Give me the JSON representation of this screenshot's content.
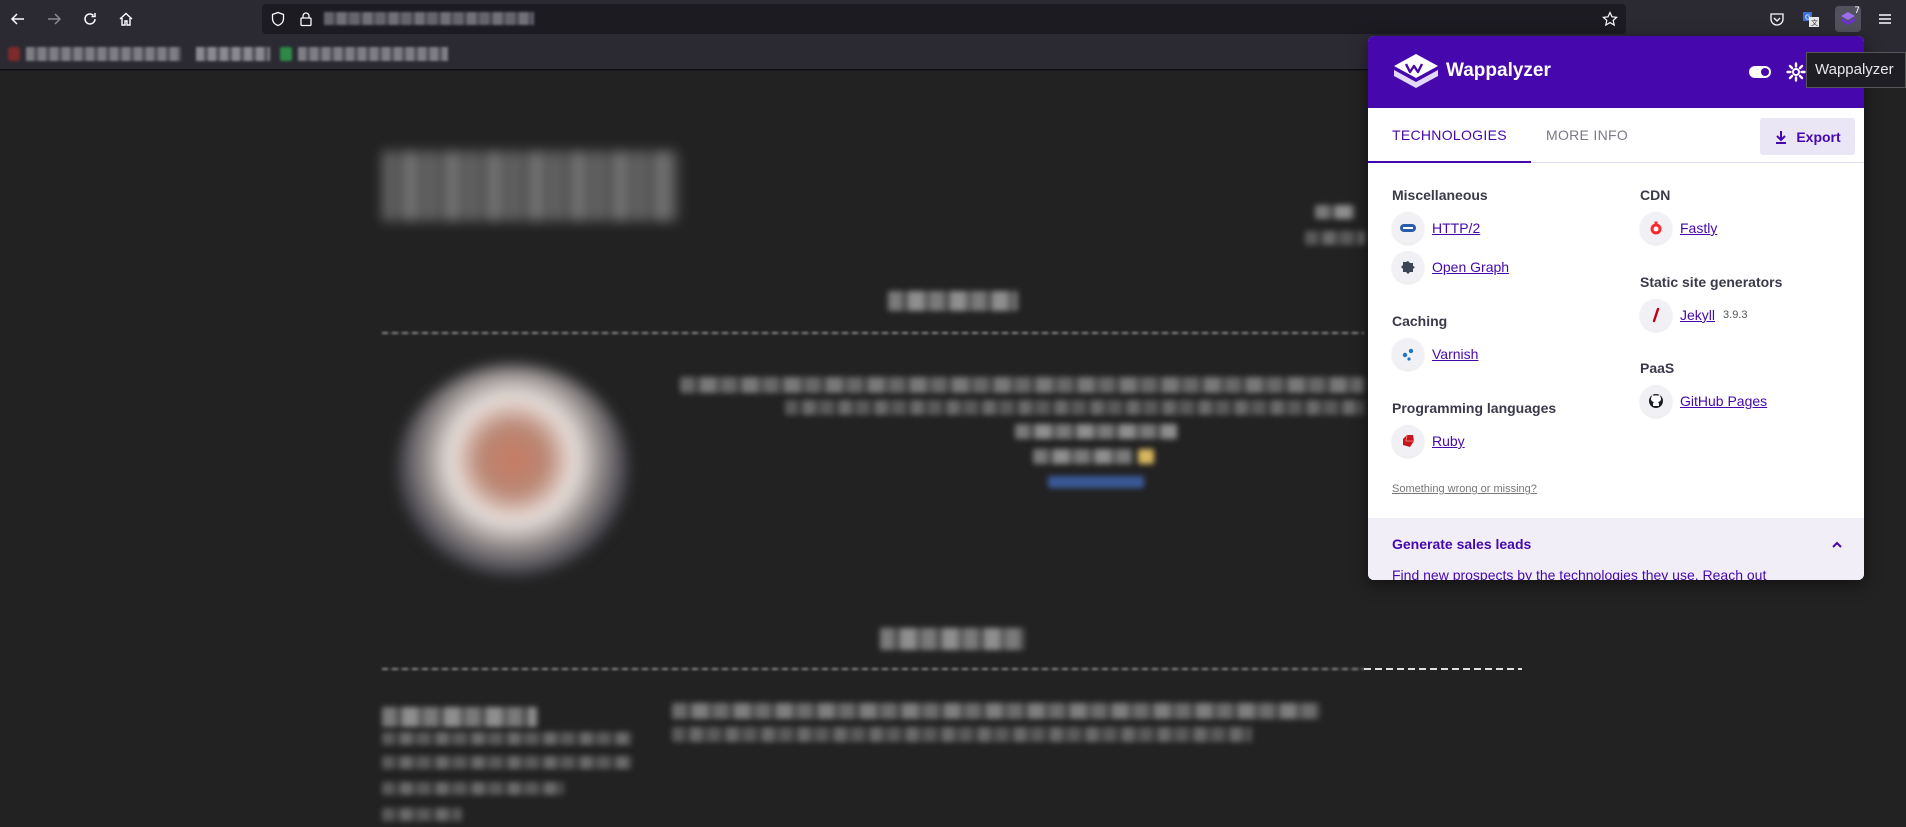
{
  "browser": {
    "toolbar": {
      "back": "back-icon",
      "forward": "forward-icon",
      "reload": "reload-icon",
      "home": "home-icon",
      "extension_badge": "7"
    }
  },
  "popup": {
    "brand": "Wappalyzer",
    "brand_color": "#4608ad",
    "tabs": [
      {
        "label": "TECHNOLOGIES",
        "active": true
      },
      {
        "label": "MORE INFO",
        "active": false
      }
    ],
    "export_label": "Export",
    "categories": {
      "miscellaneous": {
        "label": "Miscellaneous",
        "items": [
          {
            "name": "HTTP/2",
            "icon": "http2-icon"
          },
          {
            "name": "Open Graph",
            "icon": "open-graph-icon"
          }
        ]
      },
      "caching": {
        "label": "Caching",
        "items": [
          {
            "name": "Varnish",
            "icon": "varnish-icon"
          }
        ]
      },
      "programming": {
        "label": "Programming languages",
        "items": [
          {
            "name": "Ruby",
            "icon": "ruby-icon"
          }
        ]
      },
      "cdn": {
        "label": "CDN",
        "items": [
          {
            "name": "Fastly",
            "icon": "fastly-icon"
          }
        ]
      },
      "ssg": {
        "label": "Static site generators",
        "items": [
          {
            "name": "Jekyll",
            "version": "3.9.3",
            "icon": "jekyll-icon"
          }
        ]
      },
      "paas": {
        "label": "PaaS",
        "items": [
          {
            "name": "GitHub Pages",
            "icon": "github-icon"
          }
        ]
      }
    },
    "feedback_link": "Something wrong or missing?",
    "leads": {
      "title": "Generate sales leads",
      "text": "Find new prospects by the technologies they use. Reach out"
    }
  },
  "tooltip": "Wappalyzer"
}
